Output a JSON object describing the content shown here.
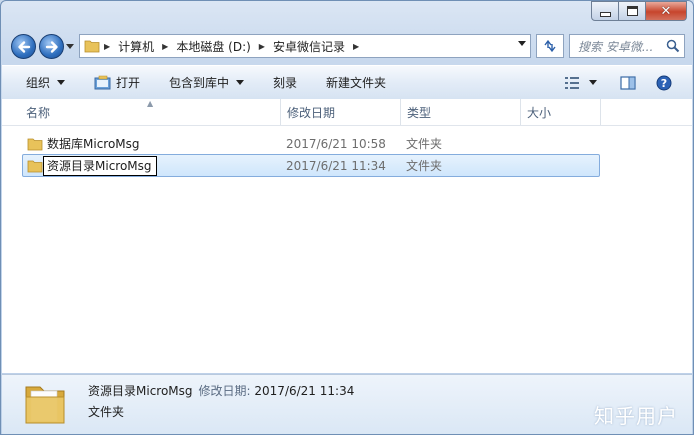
{
  "window": {
    "minimize": "—",
    "maximize": "□",
    "close": "✕"
  },
  "address": {
    "crumbs": [
      "计算机",
      "本地磁盘 (D:)",
      "安卓微信记录"
    ],
    "search_placeholder": "搜索 安卓微..."
  },
  "toolbar": {
    "organize": "组织",
    "open": "打开",
    "include_library": "包含到库中",
    "burn": "刻录",
    "new_folder": "新建文件夹"
  },
  "columns": {
    "name": "名称",
    "date": "修改日期",
    "type": "类型",
    "size": "大小"
  },
  "files": [
    {
      "name": "数据库MicroMsg",
      "date": "2017/6/21 10:58",
      "type": "文件夹",
      "size": ""
    },
    {
      "name": "资源目录MicroMsg",
      "date": "2017/6/21 11:34",
      "type": "文件夹",
      "size": ""
    }
  ],
  "details": {
    "name": "资源目录MicroMsg",
    "date_label": "修改日期:",
    "date_value": "2017/6/21 11:34",
    "type": "文件夹"
  },
  "watermark": "知乎用户",
  "icons": [
    "back-arrow-icon",
    "forward-arrow-icon",
    "recent-pages-icon",
    "folder-icon",
    "breadcrumb-separator-icon",
    "refresh-icon",
    "search-icon",
    "open-icon",
    "view-options-icon",
    "preview-pane-icon",
    "help-icon"
  ],
  "colors": {
    "accent": "#2f6fbe",
    "selection": "#cfe6fc",
    "folder": "#e8c25a"
  }
}
